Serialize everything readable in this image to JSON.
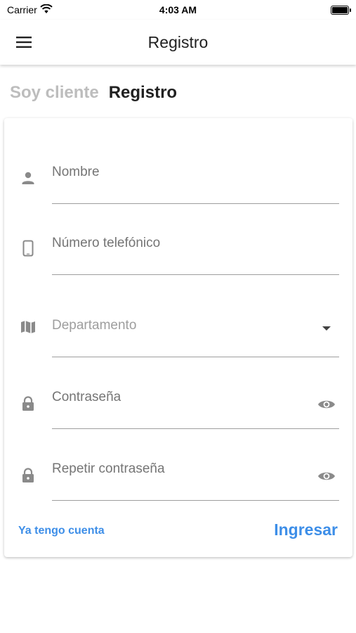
{
  "status_bar": {
    "carrier": "Carrier",
    "time": "4:03 AM"
  },
  "app_bar": {
    "title": "Registro"
  },
  "tabs": {
    "inactive": "Soy cliente",
    "active": "Registro"
  },
  "form": {
    "name": {
      "placeholder": "Nombre",
      "value": ""
    },
    "phone": {
      "placeholder": "Número telefónico",
      "value": ""
    },
    "department": {
      "placeholder": "Departamento"
    },
    "password": {
      "placeholder": "Contraseña",
      "value": ""
    },
    "repeat_password": {
      "placeholder": "Repetir contraseña",
      "value": ""
    }
  },
  "actions": {
    "have_account": "Ya tengo cuenta",
    "login": "Ingresar"
  },
  "colors": {
    "accent": "#3d8ee8",
    "icon": "#8a8a8a",
    "tab_inactive": "#bdbdbd"
  }
}
